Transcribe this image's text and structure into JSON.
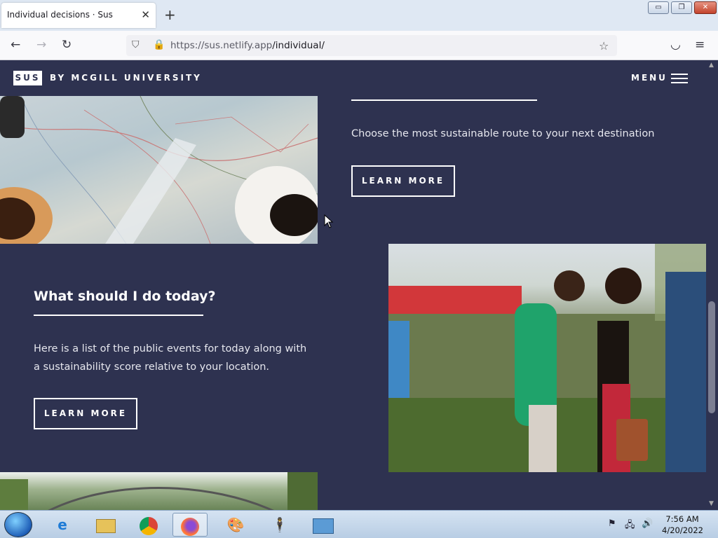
{
  "browser": {
    "tab_title": "Individual decisions · Sus",
    "tab_close": "✕",
    "new_tab": "+",
    "url_scheme_host": "https://sus.netlify.app",
    "url_path": "/individual/",
    "win_min": "▭",
    "win_max": "❐",
    "win_close": "✕"
  },
  "site": {
    "logo": "SUS",
    "logo_sub": "BY MCGILL UNIVERSITY",
    "menu_label": "MENU"
  },
  "sections": {
    "route": {
      "description": "Choose the most sustainable route to your next destination",
      "button": "LEARN MORE"
    },
    "today": {
      "title": "What should I do today?",
      "description": "Here is a list of the public events for today along with a sustainability score relative to your location.",
      "button": "LEARN MORE"
    }
  },
  "taskbar": {
    "apps": [
      "internet-explorer",
      "file-explorer",
      "chrome",
      "firefox",
      "paint",
      "stickman",
      "control-panel"
    ],
    "time": "7:56 AM",
    "date": "4/20/2022"
  },
  "colors": {
    "page_bg": "#2e3250",
    "text": "#ffffff"
  }
}
